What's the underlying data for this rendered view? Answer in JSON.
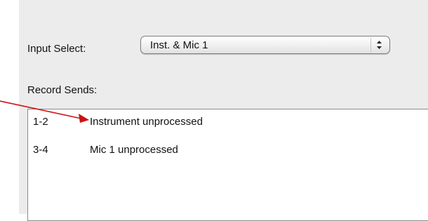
{
  "input_select": {
    "label": "Input Select:",
    "value": "Inst. & Mic 1",
    "arrows_icon": "up-down-arrows-icon"
  },
  "record_sends": {
    "label": "Record Sends:",
    "items": [
      {
        "channels": "1-2",
        "name": "Instrument unprocessed"
      },
      {
        "channels": "3-4",
        "name": "Mic 1 unprocessed"
      }
    ]
  },
  "annotation": {
    "arrow_color": "#cc1111"
  }
}
